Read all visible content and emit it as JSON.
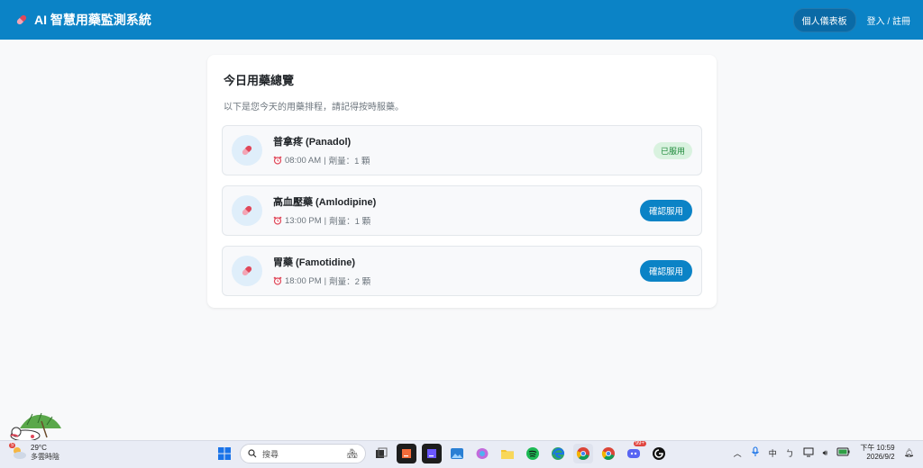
{
  "header": {
    "title": "AI 智慧用藥監測系統",
    "dashboard_label": "個人儀表板",
    "login_label": "登入 / 註冊"
  },
  "overview": {
    "title": "今日用藥總覽",
    "subtitle": "以下是您今天的用藥排程，請記得按時服藥。",
    "meds": [
      {
        "name": "普拿疼 (Panadol)",
        "time": "08:00 AM",
        "dose": "劑量：1 顆",
        "status": "已服用"
      },
      {
        "name": "高血壓藥 (Amlodipine)",
        "time": "13:00 PM",
        "dose": "劑量：1 顆",
        "action": "確認服用"
      },
      {
        "name": "胃藥 (Famotidine)",
        "time": "18:00 PM",
        "dose": "劑量：2 顆",
        "action": "確認服用"
      }
    ]
  },
  "taskbar": {
    "weather_temp": "29°C",
    "weather_desc": "多雲時陰",
    "weather_badge": "5",
    "search_placeholder": "搜尋",
    "ime": "中",
    "clock_time": "下午 10:59",
    "clock_date": "2026/9/2",
    "discord_badge": "99+"
  },
  "colors": {
    "primary": "#0b83c6",
    "taken_bg": "#d9f2df",
    "taken_text": "#1f8a3b"
  }
}
